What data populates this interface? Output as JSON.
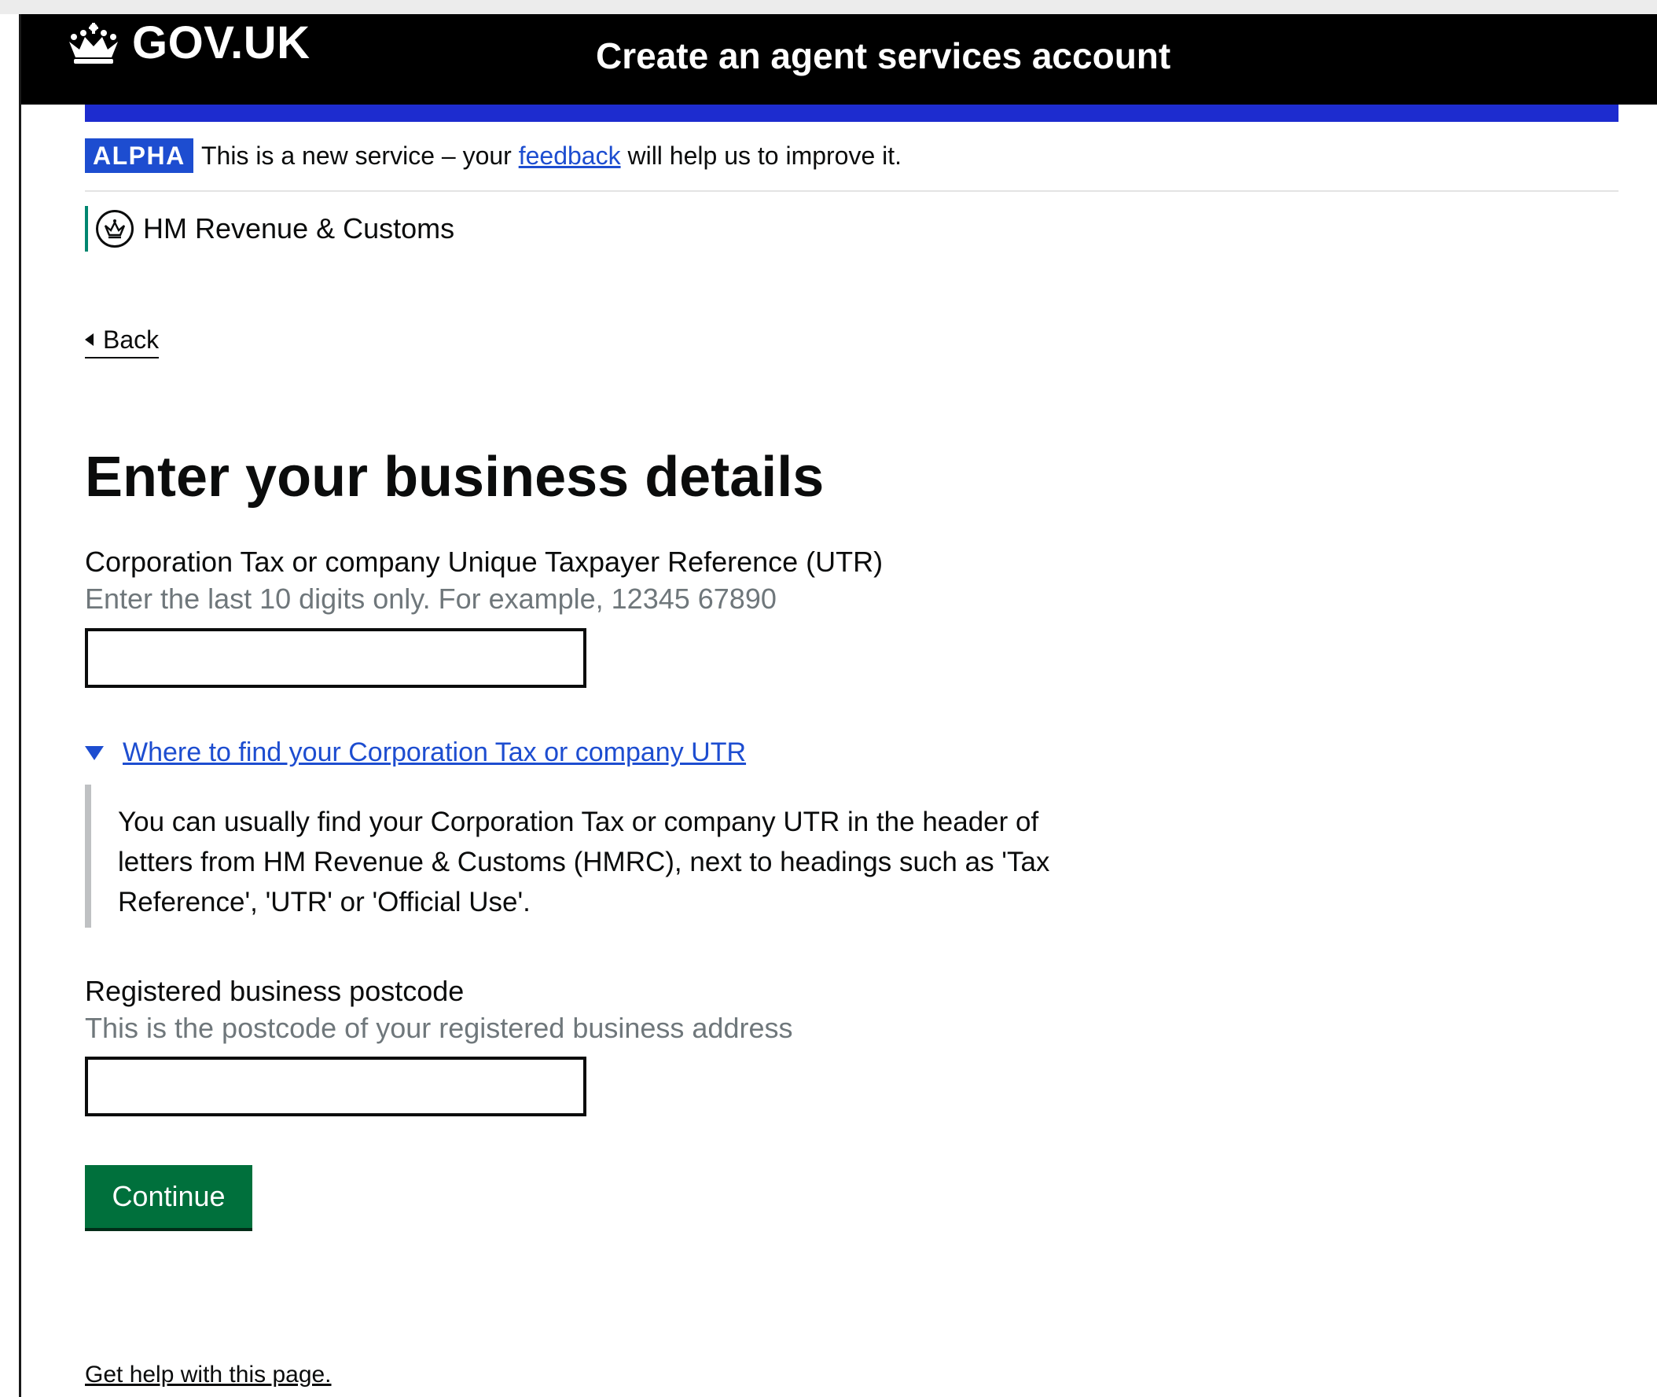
{
  "header": {
    "logo_text": "GOV.UK",
    "service_name": "Create an agent services account"
  },
  "phase_banner": {
    "tag": "ALPHA",
    "text_before": "This is a new service – your ",
    "link_text": "feedback",
    "text_after": " will help us to improve it."
  },
  "organisation": {
    "name": "HM Revenue & Customs"
  },
  "back_link": {
    "label": "Back"
  },
  "page": {
    "title": "Enter your business details"
  },
  "utr_field": {
    "label": "Corporation Tax or company Unique Taxpayer Reference (UTR)",
    "hint": "Enter the last 10 digits only. For example, 12345 67890",
    "value": ""
  },
  "utr_details": {
    "summary": "Where to find your Corporation Tax or company UTR",
    "body": "You can usually find your Corporation Tax or company UTR in the header of letters from HM Revenue & Customs (HMRC), next to headings such as 'Tax Reference', 'UTR' or 'Official Use'."
  },
  "postcode_field": {
    "label": "Registered business postcode",
    "hint": "This is the postcode of your registered business address",
    "value": ""
  },
  "actions": {
    "continue_label": "Continue"
  },
  "footer": {
    "help_link": "Get help with this page."
  },
  "icons": {
    "crown": "crown-icon",
    "org_crest": "hmrc-crest-icon",
    "back": "chevron-left-icon",
    "details_toggle": "triangle-down-icon"
  },
  "colors": {
    "header_bg": "#000000",
    "blue_bar": "#1d2ccf",
    "phase_tag": "#1d4dd0",
    "link": "#1d4dd0",
    "org_line": "#008670",
    "button": "#00703c",
    "hint_text": "#6f777b"
  }
}
